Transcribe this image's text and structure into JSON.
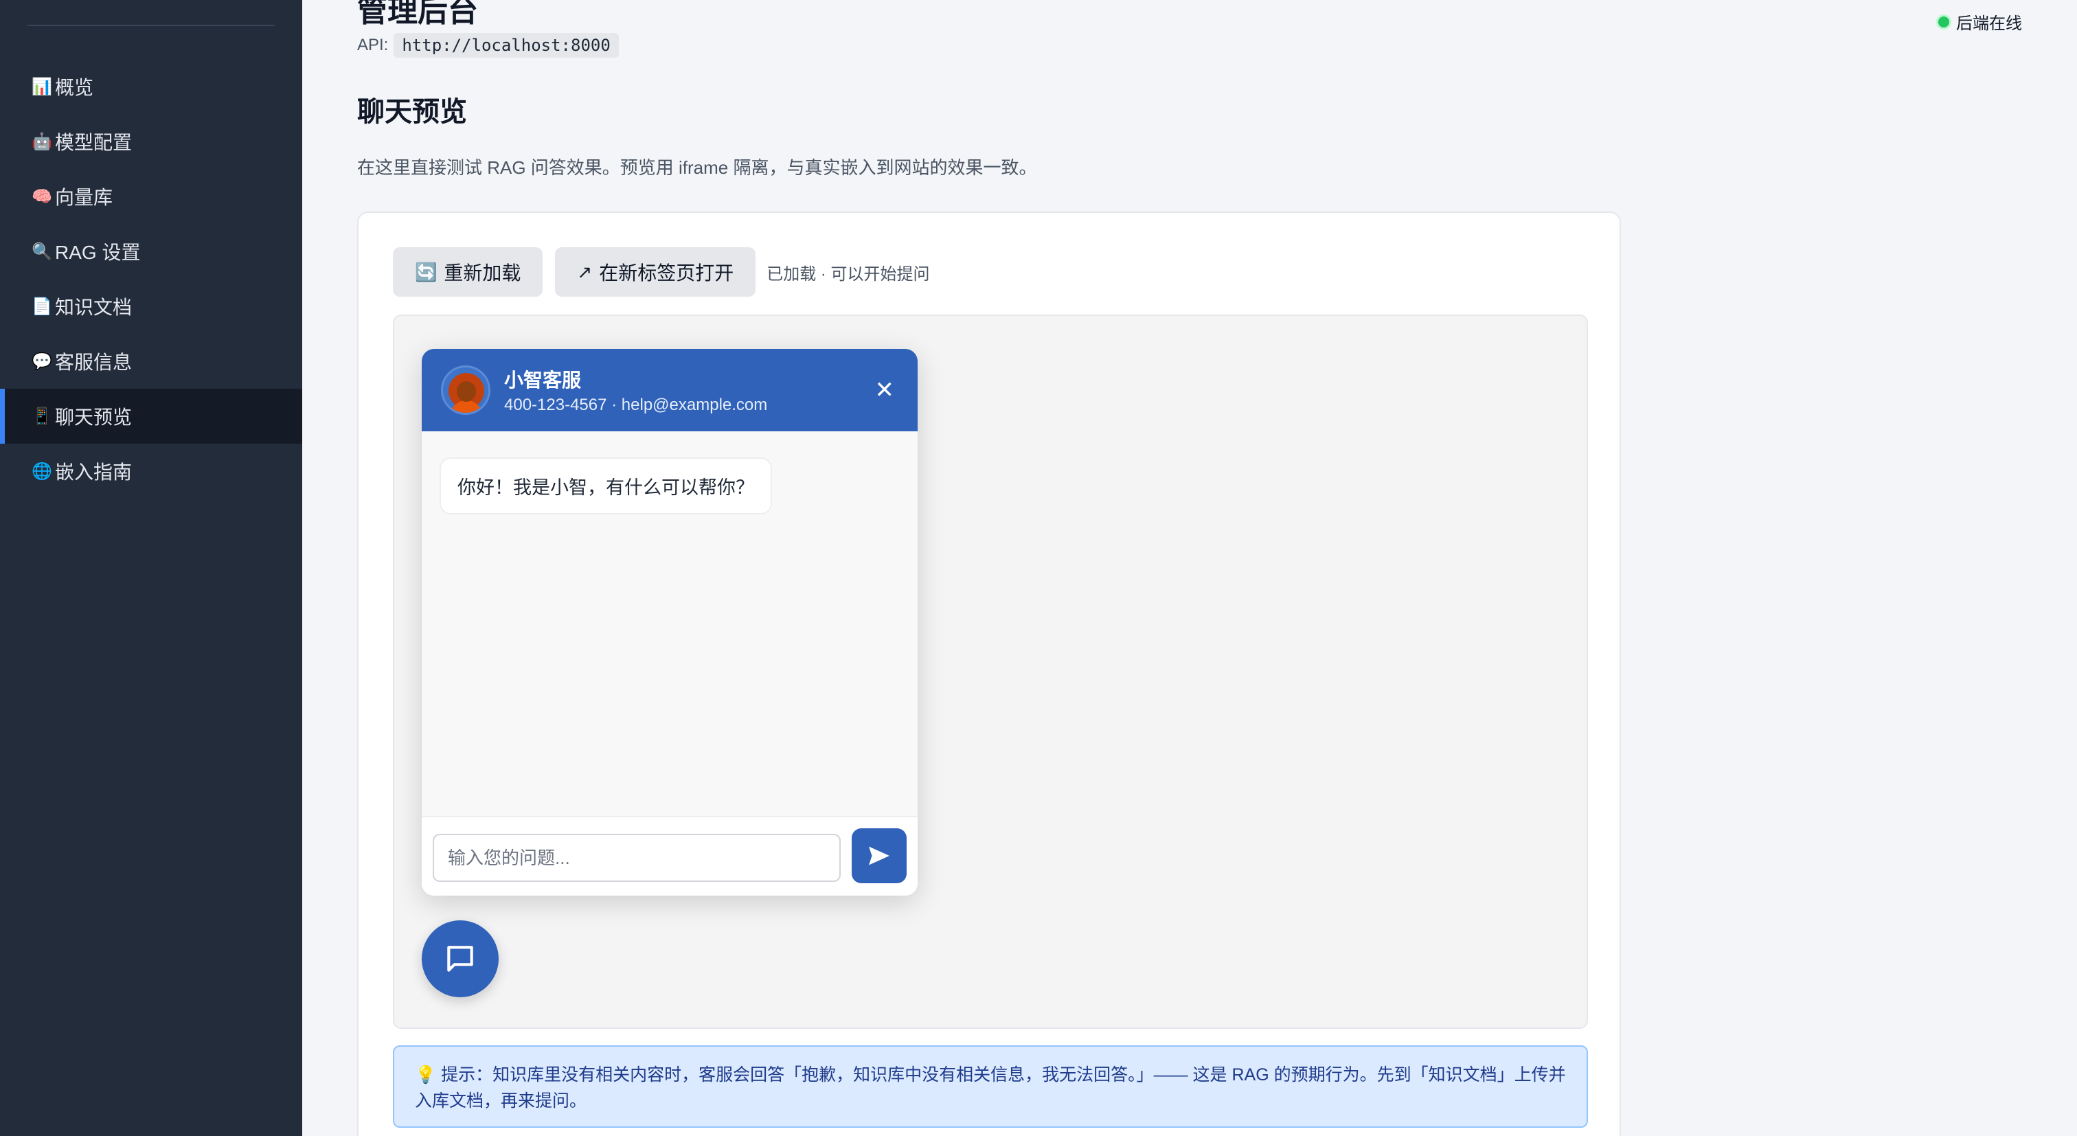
{
  "app": {
    "title": "管理后台",
    "api_label": "API:",
    "api_url": "http://localhost:8000",
    "status": "后端在线"
  },
  "sidebar": {
    "items": [
      {
        "icon": "📊",
        "icon_name": "chart-icon",
        "label": "概览"
      },
      {
        "icon": "🤖",
        "icon_name": "robot-icon",
        "label": "模型配置"
      },
      {
        "icon": "🧠",
        "icon_name": "brain-icon",
        "label": "向量库"
      },
      {
        "icon": "🔍",
        "icon_name": "search-icon",
        "label": "RAG 设置"
      },
      {
        "icon": "📄",
        "icon_name": "document-icon",
        "label": "知识文档"
      },
      {
        "icon": "💬",
        "icon_name": "speech-bubble-icon",
        "label": "客服信息"
      },
      {
        "icon": "📱",
        "icon_name": "phone-icon",
        "label": "聊天预览",
        "active": true
      },
      {
        "icon": "🌐",
        "icon_name": "globe-icon",
        "label": "嵌入指南"
      }
    ]
  },
  "page": {
    "title": "聊天预览",
    "description": "在这里直接测试 RAG 问答效果。预览用 iframe 隔离，与真实嵌入到网站的效果一致。"
  },
  "toolbar": {
    "reload_icon": "🔄",
    "reload_label": "重新加载",
    "open_icon": "↗",
    "open_label": "在新标签页打开",
    "status": "已加载 · 可以开始提问"
  },
  "widget": {
    "name": "小智客服",
    "contact": "400-123-4567 · help@example.com",
    "close": "✕",
    "greeting": "你好！我是小智，有什么可以帮你？",
    "input_placeholder": "输入您的问题..."
  },
  "tip": {
    "icon": "💡",
    "text": "提示：知识库里没有相关内容时，客服会回答「抱歉，知识库中没有相关信息，我无法回答。」—— 这是 RAG 的预期行为。先到「知识文档」上传并入库文档，再来提问。"
  },
  "colors": {
    "sidebar_bg": "#232c3b",
    "active_accent": "#3b82f6",
    "widget_primary": "#2f62b8",
    "status_online": "#22c55e",
    "tip_bg": "#dbeafe"
  }
}
